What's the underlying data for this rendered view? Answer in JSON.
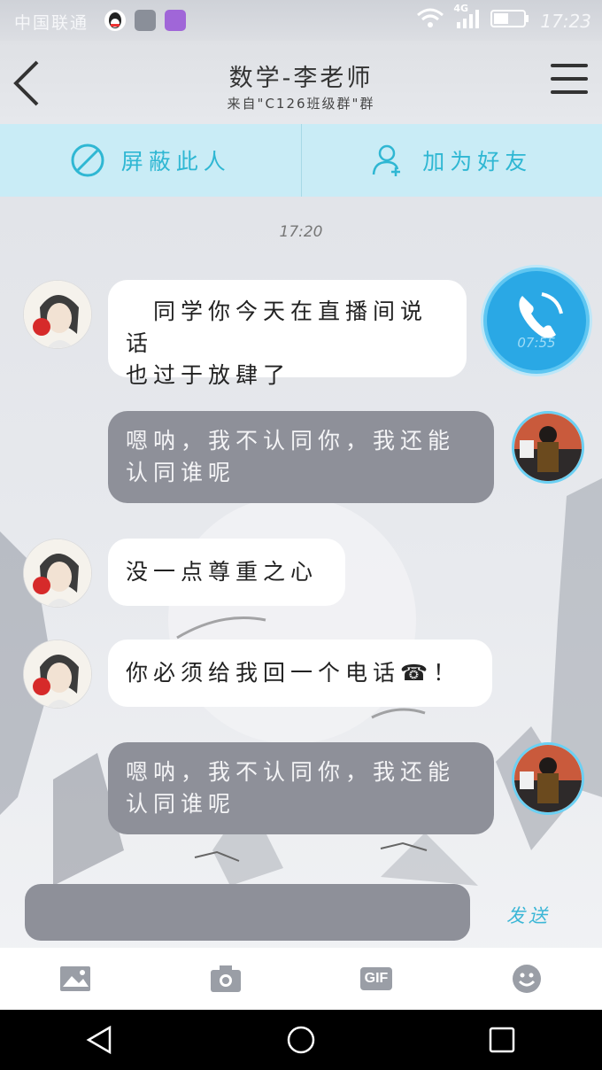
{
  "status_bar": {
    "carrier": "中国联通",
    "network": "4G",
    "time": "17:23"
  },
  "header": {
    "back_icon": "chevron-left-icon",
    "title": "数学-李老师",
    "subtitle": "来自\"C126班级群\"群",
    "menu_icon": "hamburger-menu-icon"
  },
  "actions": {
    "block": {
      "label": "屏蔽此人",
      "icon": "block-icon"
    },
    "add_friend": {
      "label": "加为好友",
      "icon": "add-user-icon"
    }
  },
  "chat": {
    "timestamp": "17:20",
    "call_duration": "07:55",
    "messages": [
      {
        "side": "in",
        "line1": "　同学你今天在直播间说话",
        "line2": "也过于放肆了"
      },
      {
        "side": "out",
        "line1": "嗯呐，我不认同你，我还能",
        "line2": "认同谁呢"
      },
      {
        "side": "in",
        "line1": "没一点尊重之心"
      },
      {
        "side": "in",
        "line1": "你必须给我回一个电话☎！"
      },
      {
        "side": "out",
        "line1": "嗯呐，我不认同你，我还能",
        "line2": "认同谁呢"
      }
    ]
  },
  "input": {
    "value": "",
    "send_label": "发送"
  },
  "toolbar": {
    "items": [
      "image-icon",
      "camera-icon",
      "gif-icon",
      "emoji-icon"
    ],
    "gif_label": "GIF"
  },
  "colors": {
    "accent": "#2fb7d3",
    "action_bar_bg": "#c9ecf6",
    "outgoing_bubble": "#8e9099",
    "incoming_bubble": "#ffffff",
    "call_button": "#2aa8e5"
  }
}
